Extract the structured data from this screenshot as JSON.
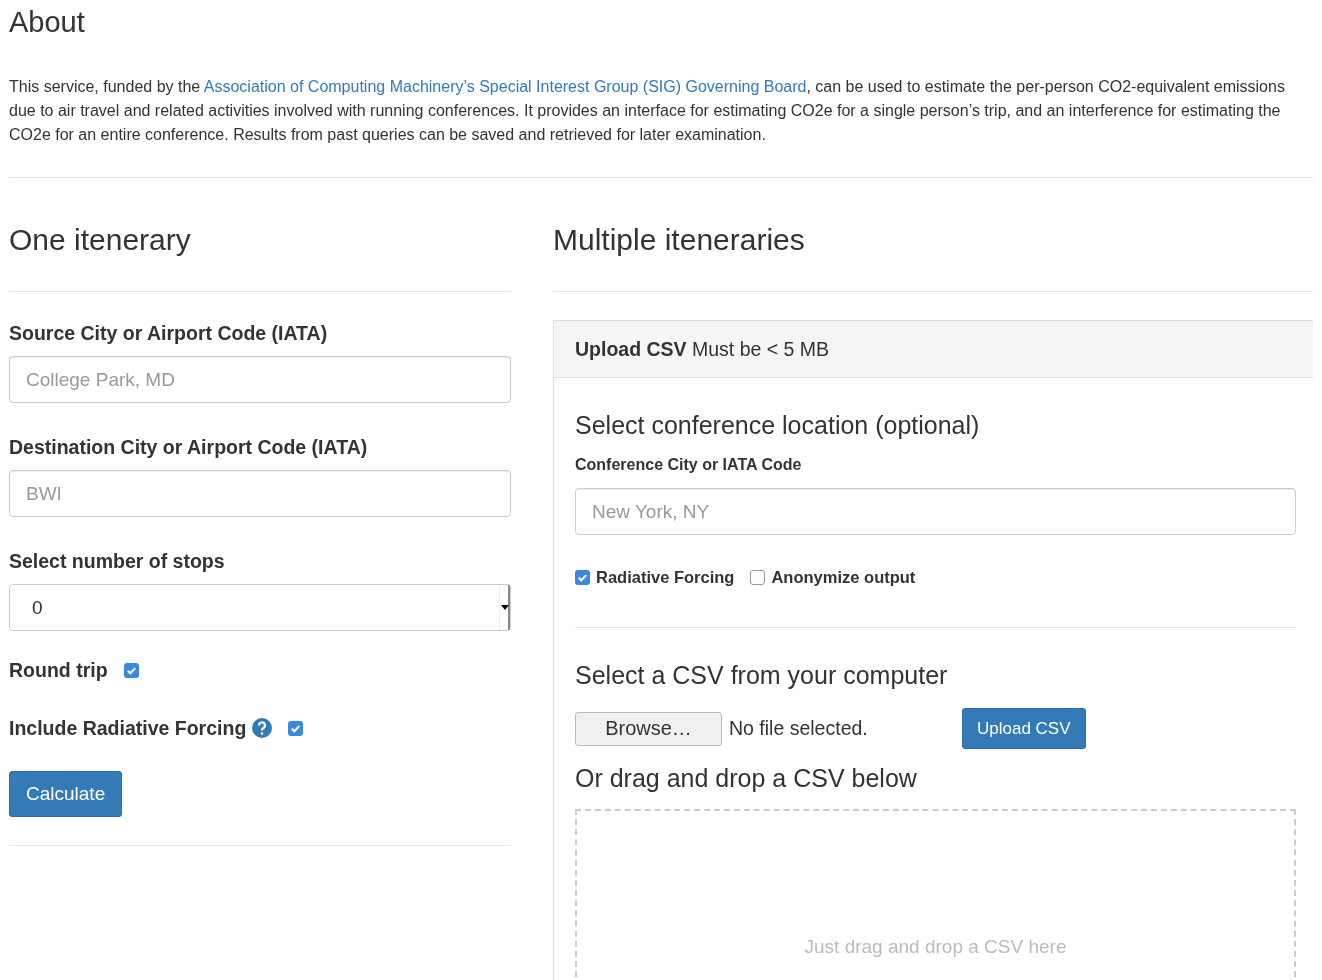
{
  "about": {
    "title": "About",
    "text_before": "This service, funded by the ",
    "link": "Association of Computing Machinery’s Special Interest Group (SIG) Governing Board",
    "text_after": ", can be used to estimate the per-person CO2-equivalent emissions due to air travel and related activities involved with running conferences. It provides an interface for estimating CO2e for a single person’s trip, and an interference for estimating the CO2e for an entire conference. Results from past queries can be saved and retrieved for later examination."
  },
  "single": {
    "title": "One itenerary",
    "fields": [
      {
        "label": "Source City or Airport Code (IATA)",
        "placeholder": "College Park, MD"
      },
      {
        "label": "Destination City or Airport Code (IATA)",
        "placeholder": "BWI"
      }
    ],
    "stops": {
      "label": "Select number of stops",
      "value": "0"
    },
    "options": [
      {
        "label": "Round trip",
        "help": false,
        "checked": true
      },
      {
        "label": "Include Radiative Forcing",
        "help": true,
        "checked": true
      }
    ],
    "button": "Calculate"
  },
  "multiple": {
    "title": "Multiple iteneraries",
    "panel_header": "**Upload CSV** Must be < 5 MB",
    "location_title": "Select conference location (optional)",
    "location_label": "Conference City or IATA Code",
    "location_placeholder": "New York, NY",
    "checkboxes": [
      {
        "label": "Radiative Forcing",
        "checked": true
      },
      {
        "label": "Anonymize output",
        "checked": false
      }
    ],
    "file_title": "Select a CSV from your computer",
    "browse_button": "Browse…",
    "file_status": "No file selected.",
    "upload_button": "Upload CSV",
    "drag_title": "Or drag and drop a CSV below",
    "drop_hint": "Just drag and drop a CSV here"
  }
}
